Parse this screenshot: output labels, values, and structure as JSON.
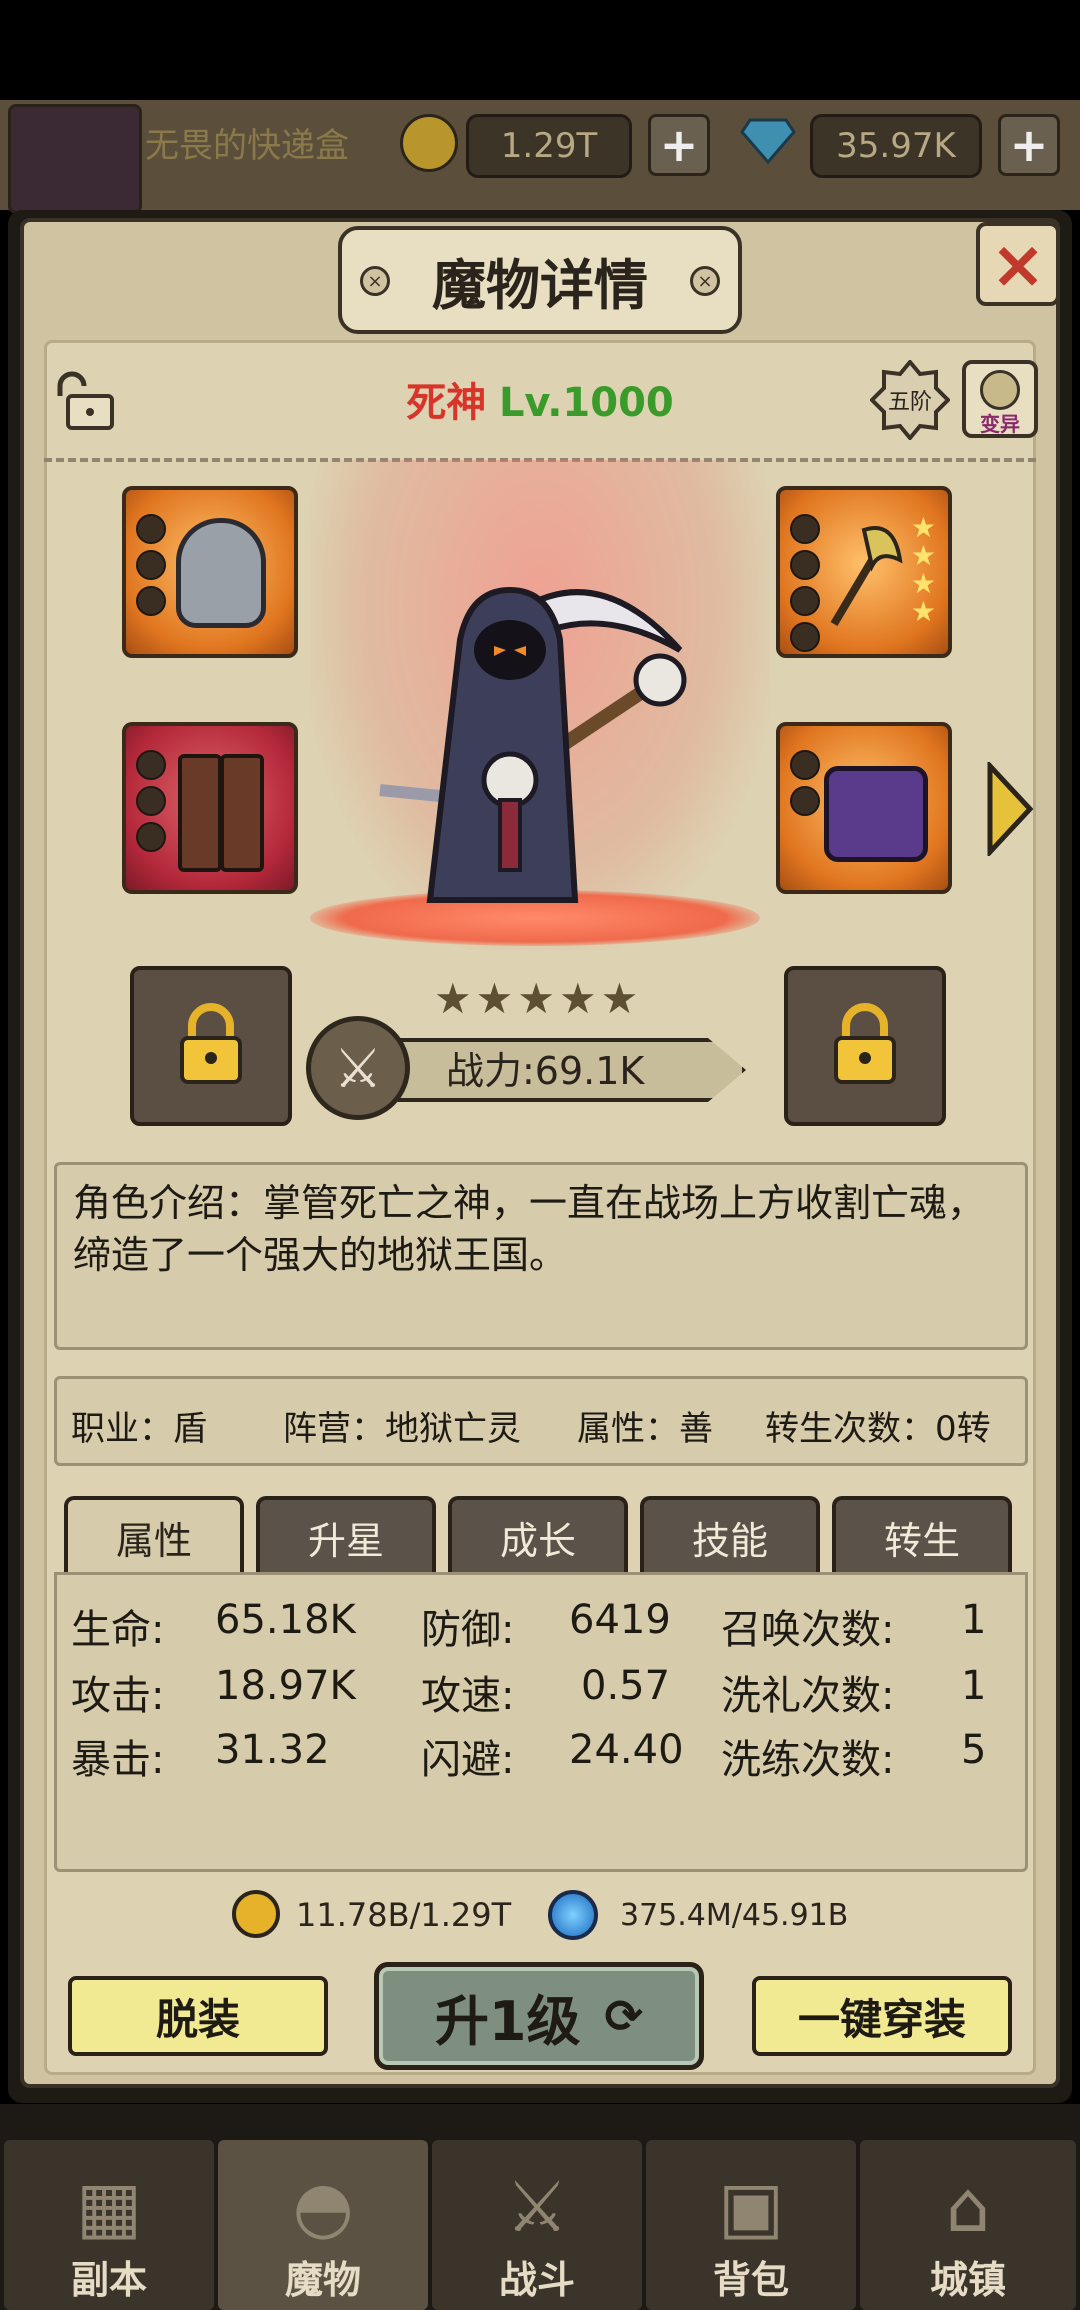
{
  "topbar": {
    "player_name": "无畏的快递盒",
    "gold": "1.29T",
    "diamonds": "35.97K"
  },
  "dialog": {
    "title": "魔物详情",
    "close_icon": "×"
  },
  "monster": {
    "name": "死神",
    "level": "Lv.1000",
    "rank_badge": "五阶",
    "variant_badge": "变异",
    "stars": 5,
    "power": "战力:69.1K",
    "description": "角色介绍：掌管死亡之神，一直在战场上方收割亡魂，缔造了一个强大的地狱王国。",
    "info": {
      "job": "职业：盾",
      "faction": "阵营：地狱亡灵",
      "alignment": "属性：善",
      "rebirth": "转生次数：0转"
    }
  },
  "tabs": [
    "属性",
    "升星",
    "成长",
    "技能",
    "转生"
  ],
  "active_tab": 0,
  "attributes": [
    {
      "label": "生命:",
      "value": "65.18K"
    },
    {
      "label": "防御:",
      "value": "6419"
    },
    {
      "label": "召唤次数:",
      "value": "1"
    },
    {
      "label": "攻击:",
      "value": "18.97K"
    },
    {
      "label": "攻速:",
      "value": "0.57"
    },
    {
      "label": "洗礼次数:",
      "value": "1"
    },
    {
      "label": "暴击:",
      "value": "31.32"
    },
    {
      "label": "闪避:",
      "value": "24.40"
    },
    {
      "label": "洗练次数:",
      "value": "5"
    }
  ],
  "resources": {
    "gold": "11.78B/1.29T",
    "essence": "375.4M/45.91B"
  },
  "buttons": {
    "unequip": "脱装",
    "upgrade": "升1级",
    "equip_all": "一键穿装"
  },
  "nav": [
    "副本",
    "魔物",
    "战斗",
    "背包",
    "城镇"
  ],
  "nav_active": 1,
  "colors": {
    "name_red": "#d8352a",
    "level_green": "#3a9a2a",
    "button_yellow": "#f2ea93",
    "panel_tan": "#ddd2b2"
  }
}
